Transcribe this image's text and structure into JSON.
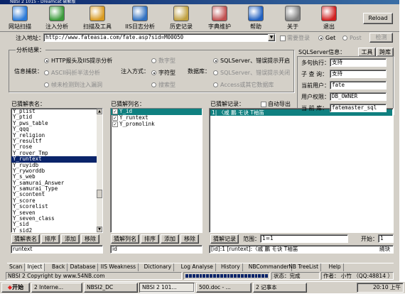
{
  "window": {
    "title": "NBSI 2 1015 - Dreamcat 破解版"
  },
  "toolbar": [
    {
      "label": "网站扫描",
      "icon": "globe-scan-icon",
      "color": "#2a7ad8"
    },
    {
      "label": "注入分析",
      "icon": "inject-analysis-icon",
      "color": "#3a9a3a"
    },
    {
      "label": "扫描及工具",
      "icon": "scan-tools-icon",
      "color": "#d89a20"
    },
    {
      "label": "IIS日志分析",
      "icon": "iis-log-icon",
      "color": "#3070c0"
    },
    {
      "label": "历史记录",
      "icon": "history-icon",
      "color": "#c0a040"
    },
    {
      "label": "字典维护",
      "icon": "dictionary-icon",
      "color": "#c05050"
    },
    {
      "label": "帮助",
      "icon": "help-icon",
      "color": "#2060c0"
    },
    {
      "label": "关于",
      "icon": "about-icon",
      "color": "#808080"
    },
    {
      "label": "退出",
      "icon": "exit-icon",
      "color": "#d02020"
    }
  ],
  "reload_label": "Reload",
  "url_bar": {
    "label": "注入地址：",
    "value": "http://www.fateasia.com/fate.asp?sid=M00050",
    "need_login": "需要登录",
    "get": "Get",
    "post": "Post",
    "detect": "检测"
  },
  "analysis": {
    "title": "分析结果：",
    "info_capture": "信息捕获：",
    "http_err": "HTTP报头及IIS提示分析",
    "ascii": "ASCII码折半法分析",
    "keyword": "帧未检测到注入漏洞",
    "inject_mode": "注入方式：",
    "numeric": "数字型",
    "string": "字符型",
    "search": "搜索型",
    "db": "数据库：",
    "sqlserver_err": "SQLServer、错误提示开启",
    "sqlserver_off": "SQLServer、错误提示关闭",
    "access": "Access或其它数据库"
  },
  "sqlinfo": {
    "title": "SQLServer信息：",
    "tools": "工具",
    "lib": "跨库",
    "rows": [
      {
        "label": "多句执行：",
        "value": "支持"
      },
      {
        "label": "子 查 询：",
        "value": "支持"
      },
      {
        "label": "当前用户：",
        "value": "fate"
      },
      {
        "label": "用户权限：",
        "value": "DB_OWNER"
      },
      {
        "label": "当 前 库：",
        "value": "fatemaster_sql"
      }
    ]
  },
  "tables": {
    "title": "已猜解表名：",
    "items": [
      "Y_plist",
      "Y_ptid",
      "Y_pws_table",
      "Y_qqq",
      "Y_religion",
      "Y_resultf",
      "Y_rose",
      "Y_rover_Tmp",
      "Y_runtext",
      "Y_ruyidb",
      "Y_ryworddb",
      "Y_s_web",
      "Y_samurai_Answer",
      "Y_samurai_Type",
      "Y_scontent",
      "Y_score",
      "Y_scorelist",
      "Y_seven",
      "Y_seven_class",
      "Y_sid",
      "Y_sid2"
    ],
    "selected_index": 8,
    "buttons": [
      "猜解表名",
      "排序",
      "添加",
      "移除"
    ],
    "input": "runtext"
  },
  "columns": {
    "title": "已猜解列名：",
    "items": [
      "Y_id",
      "Y_runtext",
      "Y_promolink"
    ],
    "buttons": [
      "猜解列名",
      "排序",
      "添加",
      "移除"
    ],
    "input": "id"
  },
  "records": {
    "title": "已猜解记录：",
    "auto_export": "自动导出",
    "row": "1| 〈戚    鵬  モ诀  T袖笛",
    "guess_btn": "猜解记录",
    "range_label": "范围：",
    "range": "1=1",
    "start_label": "开始：",
    "start": "1",
    "output": "[id]:1 [runtext]:〈戚    鵬  モ诀  T袖笛",
    "output_right": "繞玦"
  },
  "tabs": [
    "Scan",
    "Inject",
    "Back",
    "Database",
    "IIS Weakness",
    "Dictionary",
    "Log Analyse",
    "History",
    "NBCommander",
    "NB TreeList",
    "Help"
  ],
  "status": {
    "copyright": "NBSI 2 Copyright by www.54NB.com",
    "state": "状态：完成",
    "author": "作者：  小竹 （QQ:48814 ）"
  },
  "taskbar": {
    "start": "开始",
    "items": [
      "2 Interne...",
      "NBSI2_DC",
      "NBSI 2 101...",
      "500.doc - ...",
      "2 记事本"
    ],
    "clock": "20:10 上午"
  }
}
